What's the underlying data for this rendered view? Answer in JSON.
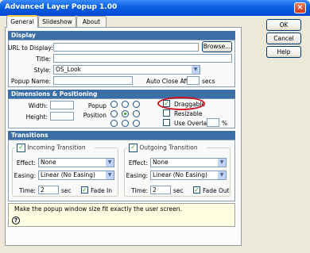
{
  "window": {
    "title": "Advanced Layer Popup 1.00",
    "close_glyph": "×"
  },
  "tabs": [
    {
      "label": "General"
    },
    {
      "label": "Slideshow"
    },
    {
      "label": "About"
    }
  ],
  "buttons": {
    "ok": "OK",
    "cancel": "Cancel",
    "help": "Help",
    "browse": "Browse..."
  },
  "display": {
    "header": "Display",
    "url_label": "URL to Display:",
    "url_value": "",
    "title_label": "Title:",
    "title_value": "",
    "style_label": "Style:",
    "style_value": "OS_Look",
    "popup_name_label": "Popup Name:",
    "popup_name_value": "",
    "auto_close_label": "Auto Close After",
    "auto_close_value": "",
    "secs": "secs"
  },
  "dimensions": {
    "header": "Dimensions & Positioning",
    "width_label": "Width:",
    "height_label": "Height:",
    "popup_label": "Popup",
    "position_label": "Position",
    "draggable": "Draggable",
    "resizable": "Resizable",
    "use_overlay": "Use Overlay",
    "percent": "%",
    "draggable_checked": true,
    "resizable_checked": false,
    "use_overlay_checked": false
  },
  "transitions": {
    "header": "Transitions",
    "incoming": {
      "title": "Incoming Transition",
      "effect_label": "Effect:",
      "effect_value": "None",
      "easing_label": "Easing:",
      "easing_value": "Linear (No Easing)",
      "time_label": "Time:",
      "time_value": "2",
      "sec": "sec",
      "fade_label": "Fade In",
      "fade_checked": true
    },
    "outgoing": {
      "title": "Outgoing Transition",
      "effect_label": "Effect:",
      "effect_value": "None",
      "easing_label": "Easing:",
      "easing_value": "Linear (No Easing)",
      "time_label": "Time:",
      "time_value": "2",
      "sec": "sec",
      "fade_label": "Fade Out",
      "fade_checked": true
    }
  },
  "hint": {
    "text": "Make the popup window size fit exactly the user screen.",
    "icon_glyph": "?"
  },
  "colors": {
    "titlebar": "#0a5fe0",
    "section_header": "#3a6ea5",
    "highlight_oval": "#d0101c",
    "hint_bg": "#ffffe1"
  }
}
